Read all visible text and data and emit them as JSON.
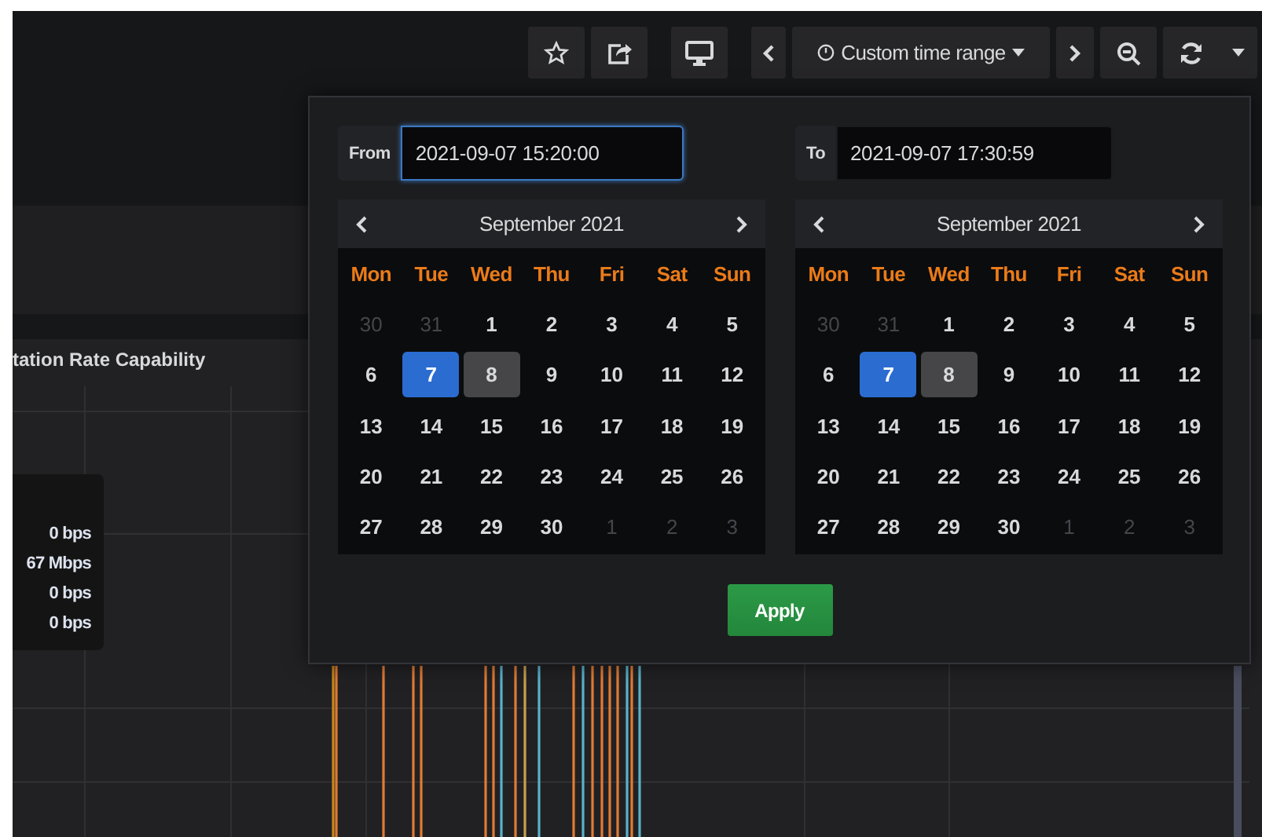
{
  "toolbar": {
    "time_range": {
      "label": "Custom time range"
    }
  },
  "graph_panel": {
    "title": "tation Rate Capability",
    "legend_values": [
      "0 bps",
      "67 Mbps",
      "0 bps",
      "0 bps"
    ]
  },
  "time_picker": {
    "from": {
      "label": "From",
      "value": "2021-09-07 15:20:00",
      "focused": true
    },
    "to": {
      "label": "To",
      "value": "2021-09-07 17:30:59",
      "focused": false
    },
    "calendars": [
      {
        "month": "September 2021",
        "weekdays": [
          "Mon",
          "Tue",
          "Wed",
          "Thu",
          "Fri",
          "Sat",
          "Sun"
        ],
        "days": [
          {
            "day": "30",
            "outside": true,
            "selected": false,
            "today": false
          },
          {
            "day": "31",
            "outside": true,
            "selected": false,
            "today": false
          },
          {
            "day": "1",
            "outside": false,
            "selected": false,
            "today": false
          },
          {
            "day": "2",
            "outside": false,
            "selected": false,
            "today": false
          },
          {
            "day": "3",
            "outside": false,
            "selected": false,
            "today": false
          },
          {
            "day": "4",
            "outside": false,
            "selected": false,
            "today": false
          },
          {
            "day": "5",
            "outside": false,
            "selected": false,
            "today": false
          },
          {
            "day": "6",
            "outside": false,
            "selected": false,
            "today": false
          },
          {
            "day": "7",
            "outside": false,
            "selected": true,
            "today": false
          },
          {
            "day": "8",
            "outside": false,
            "selected": false,
            "today": true
          },
          {
            "day": "9",
            "outside": false,
            "selected": false,
            "today": false
          },
          {
            "day": "10",
            "outside": false,
            "selected": false,
            "today": false
          },
          {
            "day": "11",
            "outside": false,
            "selected": false,
            "today": false
          },
          {
            "day": "12",
            "outside": false,
            "selected": false,
            "today": false
          },
          {
            "day": "13",
            "outside": false,
            "selected": false,
            "today": false
          },
          {
            "day": "14",
            "outside": false,
            "selected": false,
            "today": false
          },
          {
            "day": "15",
            "outside": false,
            "selected": false,
            "today": false
          },
          {
            "day": "16",
            "outside": false,
            "selected": false,
            "today": false
          },
          {
            "day": "17",
            "outside": false,
            "selected": false,
            "today": false
          },
          {
            "day": "18",
            "outside": false,
            "selected": false,
            "today": false
          },
          {
            "day": "19",
            "outside": false,
            "selected": false,
            "today": false
          },
          {
            "day": "20",
            "outside": false,
            "selected": false,
            "today": false
          },
          {
            "day": "21",
            "outside": false,
            "selected": false,
            "today": false
          },
          {
            "day": "22",
            "outside": false,
            "selected": false,
            "today": false
          },
          {
            "day": "23",
            "outside": false,
            "selected": false,
            "today": false
          },
          {
            "day": "24",
            "outside": false,
            "selected": false,
            "today": false
          },
          {
            "day": "25",
            "outside": false,
            "selected": false,
            "today": false
          },
          {
            "day": "26",
            "outside": false,
            "selected": false,
            "today": false
          },
          {
            "day": "27",
            "outside": false,
            "selected": false,
            "today": false
          },
          {
            "day": "28",
            "outside": false,
            "selected": false,
            "today": false
          },
          {
            "day": "29",
            "outside": false,
            "selected": false,
            "today": false
          },
          {
            "day": "30",
            "outside": false,
            "selected": false,
            "today": false
          },
          {
            "day": "1",
            "outside": true,
            "selected": false,
            "today": false
          },
          {
            "day": "2",
            "outside": true,
            "selected": false,
            "today": false
          },
          {
            "day": "3",
            "outside": true,
            "selected": false,
            "today": false
          }
        ]
      },
      {
        "month": "September 2021",
        "weekdays": [
          "Mon",
          "Tue",
          "Wed",
          "Thu",
          "Fri",
          "Sat",
          "Sun"
        ],
        "days": [
          {
            "day": "30",
            "outside": true,
            "selected": false,
            "today": false
          },
          {
            "day": "31",
            "outside": true,
            "selected": false,
            "today": false
          },
          {
            "day": "1",
            "outside": false,
            "selected": false,
            "today": false
          },
          {
            "day": "2",
            "outside": false,
            "selected": false,
            "today": false
          },
          {
            "day": "3",
            "outside": false,
            "selected": false,
            "today": false
          },
          {
            "day": "4",
            "outside": false,
            "selected": false,
            "today": false
          },
          {
            "day": "5",
            "outside": false,
            "selected": false,
            "today": false
          },
          {
            "day": "6",
            "outside": false,
            "selected": false,
            "today": false
          },
          {
            "day": "7",
            "outside": false,
            "selected": true,
            "today": false
          },
          {
            "day": "8",
            "outside": false,
            "selected": false,
            "today": true
          },
          {
            "day": "9",
            "outside": false,
            "selected": false,
            "today": false
          },
          {
            "day": "10",
            "outside": false,
            "selected": false,
            "today": false
          },
          {
            "day": "11",
            "outside": false,
            "selected": false,
            "today": false
          },
          {
            "day": "12",
            "outside": false,
            "selected": false,
            "today": false
          },
          {
            "day": "13",
            "outside": false,
            "selected": false,
            "today": false
          },
          {
            "day": "14",
            "outside": false,
            "selected": false,
            "today": false
          },
          {
            "day": "15",
            "outside": false,
            "selected": false,
            "today": false
          },
          {
            "day": "16",
            "outside": false,
            "selected": false,
            "today": false
          },
          {
            "day": "17",
            "outside": false,
            "selected": false,
            "today": false
          },
          {
            "day": "18",
            "outside": false,
            "selected": false,
            "today": false
          },
          {
            "day": "19",
            "outside": false,
            "selected": false,
            "today": false
          },
          {
            "day": "20",
            "outside": false,
            "selected": false,
            "today": false
          },
          {
            "day": "21",
            "outside": false,
            "selected": false,
            "today": false
          },
          {
            "day": "22",
            "outside": false,
            "selected": false,
            "today": false
          },
          {
            "day": "23",
            "outside": false,
            "selected": false,
            "today": false
          },
          {
            "day": "24",
            "outside": false,
            "selected": false,
            "today": false
          },
          {
            "day": "25",
            "outside": false,
            "selected": false,
            "today": false
          },
          {
            "day": "26",
            "outside": false,
            "selected": false,
            "today": false
          },
          {
            "day": "27",
            "outside": false,
            "selected": false,
            "today": false
          },
          {
            "day": "28",
            "outside": false,
            "selected": false,
            "today": false
          },
          {
            "day": "29",
            "outside": false,
            "selected": false,
            "today": false
          },
          {
            "day": "30",
            "outside": false,
            "selected": false,
            "today": false
          },
          {
            "day": "1",
            "outside": true,
            "selected": false,
            "today": false
          },
          {
            "day": "2",
            "outside": true,
            "selected": false,
            "today": false
          },
          {
            "day": "3",
            "outside": true,
            "selected": false,
            "today": false
          }
        ]
      }
    ],
    "apply": {
      "label": "Apply"
    }
  }
}
